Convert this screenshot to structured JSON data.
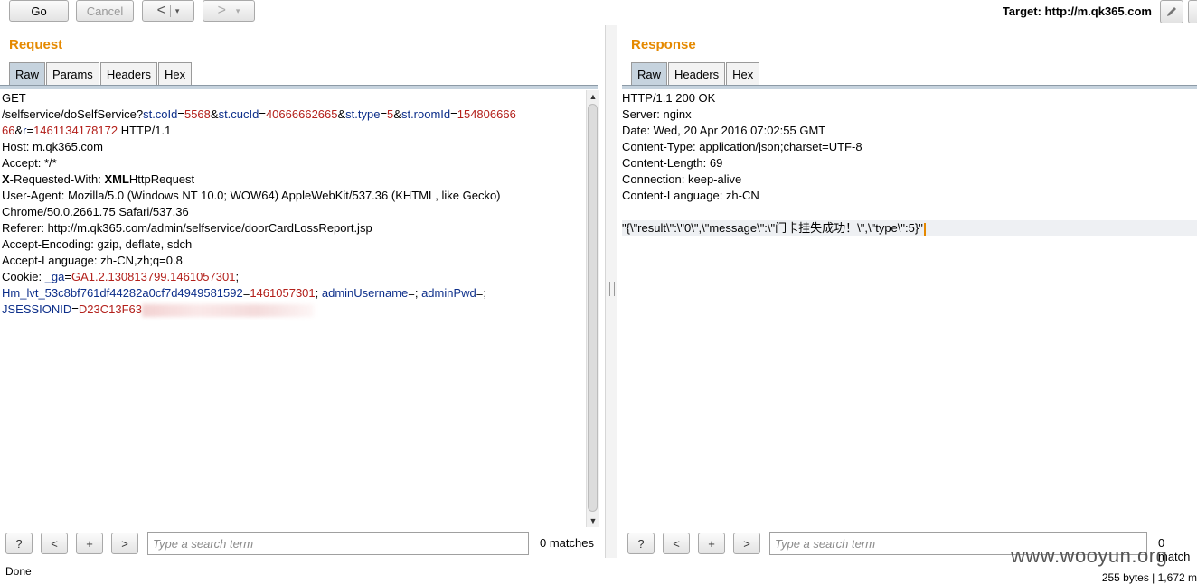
{
  "toolbar": {
    "go": "Go",
    "cancel": "Cancel",
    "back": "<",
    "forward": ">",
    "dropdown": "▾",
    "target_label": "Target: http://m.qk365.com"
  },
  "request": {
    "title": "Request",
    "tabs": [
      "Raw",
      "Params",
      "Headers",
      "Hex"
    ],
    "lines": [
      [
        {
          "t": "GET"
        }
      ],
      [
        {
          "t": "/selfservice/doSelfService?"
        },
        {
          "t": "st.coId",
          "c": "k"
        },
        {
          "t": "="
        },
        {
          "t": "5568",
          "c": "v"
        },
        {
          "t": "&"
        },
        {
          "t": "st.cucId",
          "c": "k"
        },
        {
          "t": "="
        },
        {
          "t": "40666662665",
          "c": "v"
        },
        {
          "t": "&"
        },
        {
          "t": "st.type",
          "c": "k"
        },
        {
          "t": "="
        },
        {
          "t": "5",
          "c": "v"
        },
        {
          "t": "&"
        },
        {
          "t": "st.roomId",
          "c": "k"
        },
        {
          "t": "="
        },
        {
          "t": "154806666",
          "c": "v"
        }
      ],
      [
        {
          "t": "66",
          "c": "v"
        },
        {
          "t": "&"
        },
        {
          "t": "r",
          "c": "k"
        },
        {
          "t": "="
        },
        {
          "t": "1461134178172",
          "c": "v"
        },
        {
          "t": " HTTP/1.1"
        }
      ],
      [
        {
          "t": "Host: m.qk365.com"
        }
      ],
      [
        {
          "t": "Accept: */*"
        }
      ],
      [
        {
          "t": "X",
          "c": "b"
        },
        {
          "t": "-Requested-With: "
        },
        {
          "t": "XML",
          "c": "b"
        },
        {
          "t": "HttpRequest"
        }
      ],
      [
        {
          "t": "User-Agent: Mozilla/5.0 (Windows NT 10.0; WOW64) AppleWebKit/537.36 (KHTML, like Gecko)"
        }
      ],
      [
        {
          "t": "Chrome/50.0.2661.75 Safari/537.36"
        }
      ],
      [
        {
          "t": "Referer: http://m.qk365.com/admin/selfservice/doorCardLossReport.jsp"
        }
      ],
      [
        {
          "t": "Accept-Encoding: gzip, deflate, sdch"
        }
      ],
      [
        {
          "t": "Accept-Language: zh-CN,zh;q=0.8"
        }
      ],
      [
        {
          "t": "Cookie: "
        },
        {
          "t": "_ga",
          "c": "k"
        },
        {
          "t": "="
        },
        {
          "t": "GA1.2.130813799.1461057301",
          "c": "v"
        },
        {
          "t": ";"
        }
      ],
      [
        {
          "t": "Hm_lvt_53c8bf761df44282a0cf7d4949581592",
          "c": "k"
        },
        {
          "t": "="
        },
        {
          "t": "1461057301",
          "c": "v"
        },
        {
          "t": "; "
        },
        {
          "t": "adminUsername",
          "c": "k"
        },
        {
          "t": "=; "
        },
        {
          "t": "adminPwd",
          "c": "k"
        },
        {
          "t": "=;"
        }
      ],
      [
        {
          "t": "JSESSIONID",
          "c": "k"
        },
        {
          "t": "="
        },
        {
          "t": "D23C13F63",
          "c": "v"
        },
        {
          "t": "",
          "c": "blur"
        }
      ]
    ]
  },
  "response": {
    "title": "Response",
    "tabs": [
      "Raw",
      "Headers",
      "Hex"
    ],
    "lines": [
      [
        {
          "t": "HTTP/1.1 200 OK"
        }
      ],
      [
        {
          "t": "Server: nginx"
        }
      ],
      [
        {
          "t": "Date: Wed, 20 Apr 2016 07:02:55 GMT"
        }
      ],
      [
        {
          "t": "Content-Type: application/json;charset=UTF-8"
        }
      ],
      [
        {
          "t": "Content-Length: 69"
        }
      ],
      [
        {
          "t": "Connection: keep-alive"
        }
      ],
      [
        {
          "t": "Content-Language: zh-CN"
        }
      ],
      [
        {
          "t": ""
        }
      ],
      [
        {
          "t": "\"{\\\"result\\\":\\\"0\\\",\\\"message\\\":\\\"门卡挂失成功！\\\",\\\"type\\\":5}\""
        },
        {
          "t": "",
          "c": "caret"
        }
      ]
    ]
  },
  "search": {
    "help": "?",
    "prev": "<",
    "add": "+",
    "next": ">",
    "placeholder": "Type a search term",
    "matches_left": "0 matches",
    "matches_right": "0 match"
  },
  "status": {
    "left": "Done",
    "right": "255 bytes | 1,672 m"
  },
  "watermark": "www.wooyun.org",
  "colors": {
    "accent": "#e58900",
    "key": "#0c2e8a",
    "value": "#b3201b",
    "active_tab": "#c6d3de"
  }
}
